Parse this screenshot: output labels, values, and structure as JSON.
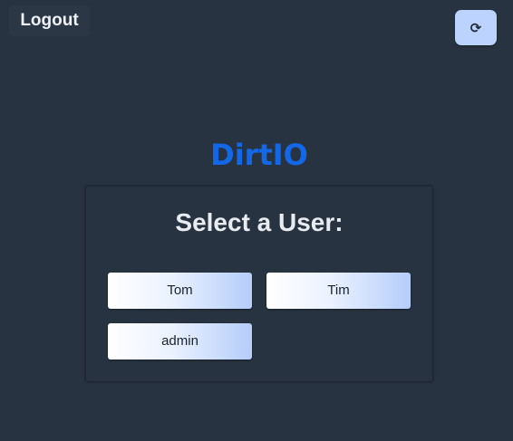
{
  "header": {
    "logout_label": "Logout",
    "refresh_icon": "refresh-icon",
    "refresh_glyph": "⟳"
  },
  "brand": {
    "name": "DirtIO",
    "color": "#1368e8"
  },
  "user_select": {
    "title": "Select a User:",
    "users": [
      {
        "label": "Tom"
      },
      {
        "label": "Tim"
      },
      {
        "label": "admin"
      }
    ]
  }
}
